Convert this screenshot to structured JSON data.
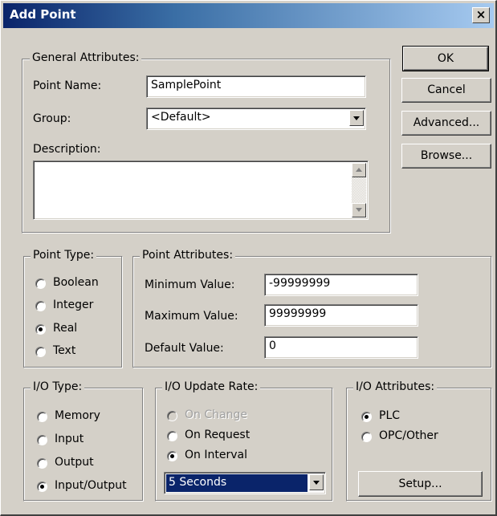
{
  "window": {
    "title": "Add Point",
    "close_glyph": "×"
  },
  "general": {
    "legend": "General Attributes:",
    "point_name_label": "Point Name:",
    "point_name_value": "SamplePoint",
    "group_label": "Group:",
    "group_value": "<Default>",
    "description_label": "Description:",
    "description_value": ""
  },
  "buttons": {
    "ok": "OK",
    "cancel": "Cancel",
    "advanced": "Advanced...",
    "browse": "Browse...",
    "setup": "Setup..."
  },
  "point_type": {
    "legend": "Point Type:",
    "options": [
      "Boolean",
      "Integer",
      "Real",
      "Text"
    ],
    "selected": "Real"
  },
  "point_attributes": {
    "legend": "Point Attributes:",
    "min_label": "Minimum Value:",
    "min_value": "-99999999",
    "max_label": "Maximum Value:",
    "max_value": "99999999",
    "default_label": "Default Value:",
    "default_value": "0"
  },
  "io_type": {
    "legend": "I/O Type:",
    "options": [
      "Memory",
      "Input",
      "Output",
      "Input/Output"
    ],
    "selected": "Input/Output"
  },
  "io_update_rate": {
    "legend": "I/O Update Rate:",
    "options": [
      "On Change",
      "On Request",
      "On Interval"
    ],
    "disabled": [
      "On Change"
    ],
    "selected": "On Interval",
    "interval_value": "5 Seconds"
  },
  "io_attributes": {
    "legend": "I/O Attributes:",
    "options": [
      "PLC",
      "OPC/Other"
    ],
    "selected": "PLC"
  },
  "colors": {
    "face": "#d4d0c8",
    "title_start": "#0a246a",
    "title_end": "#a6caf0",
    "selection": "#0a246a"
  }
}
